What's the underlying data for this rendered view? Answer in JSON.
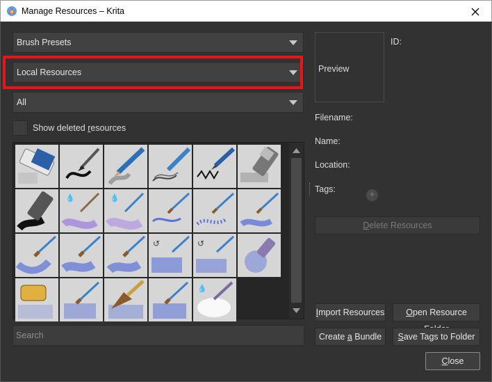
{
  "window": {
    "title": "Manage Resources – Krita",
    "app_icon": "krita-icon",
    "close_icon": "close-icon"
  },
  "filters": {
    "resource_type": "Brush Presets",
    "storage": "Local Resources",
    "tag": "All"
  },
  "show_deleted": {
    "label": "Show deleted resources",
    "checked": false
  },
  "grid": {
    "items": [
      "eraser",
      "ink-brush",
      "pencil",
      "pencil-sketch",
      "fountain-pen",
      "marker",
      "marker-ink",
      "palette-knife-purple",
      "round-brush-wet",
      "brush-blue-stroke",
      "brush-blue-dots",
      "brush-blue-wet",
      "brush-blue-wide",
      "brush-blue-flat",
      "brush-blue-round",
      "brush-blue-texture",
      "brush-blue-dry",
      "airbrush-purple",
      "sponge",
      "brush-blue-splatter",
      "fan-brush",
      "brush-blue-bristle",
      "blender-wet"
    ]
  },
  "search": {
    "placeholder": "Search"
  },
  "details": {
    "preview_label": "Preview",
    "id_label": "ID:",
    "filename_label": "Filename:",
    "name_label": "Name:",
    "location_label": "Location:",
    "tags_label": "Tags:"
  },
  "buttons": {
    "delete_prefix": "",
    "delete_u": "D",
    "delete_rest": "elete Resources",
    "import_prefix": "",
    "import_u": "I",
    "import_rest": "mport Resources",
    "open_prefix": "",
    "open_u": "O",
    "open_rest": "pen Resource Folder",
    "bundle_prefix": "Create ",
    "bundle_u": "a",
    "bundle_rest": " Bundle",
    "save_prefix": "",
    "save_u": "S",
    "save_rest": "ave Tags to Folder",
    "close_prefix": "",
    "close_u": "C",
    "close_rest": "lose"
  },
  "colors": {
    "highlight": "#e8141a",
    "background": "#323232",
    "brush_blue": "#5a72d8"
  }
}
